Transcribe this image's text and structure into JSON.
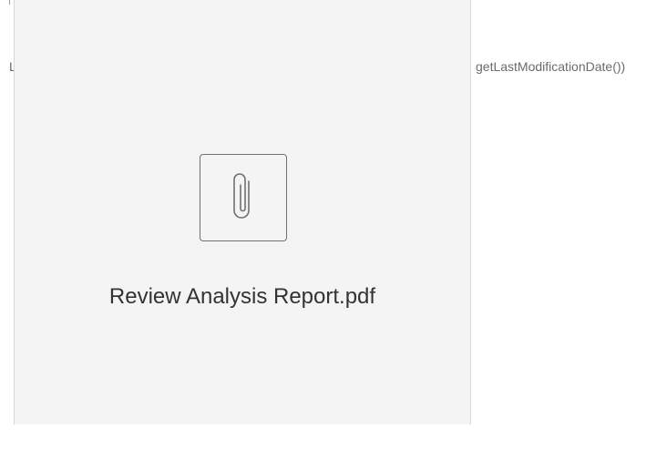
{
  "background": {
    "left_text": "L",
    "right_text": "getLastModificationDate())"
  },
  "preview": {
    "file_name": "Review Analysis Report.pdf",
    "icon": "paperclip-icon"
  },
  "colors": {
    "card_background": "#f4f4f4",
    "card_border": "#d8d8d8",
    "icon_stroke": "#707070",
    "text_primary": "#333333",
    "text_secondary": "#6b6b6b"
  }
}
